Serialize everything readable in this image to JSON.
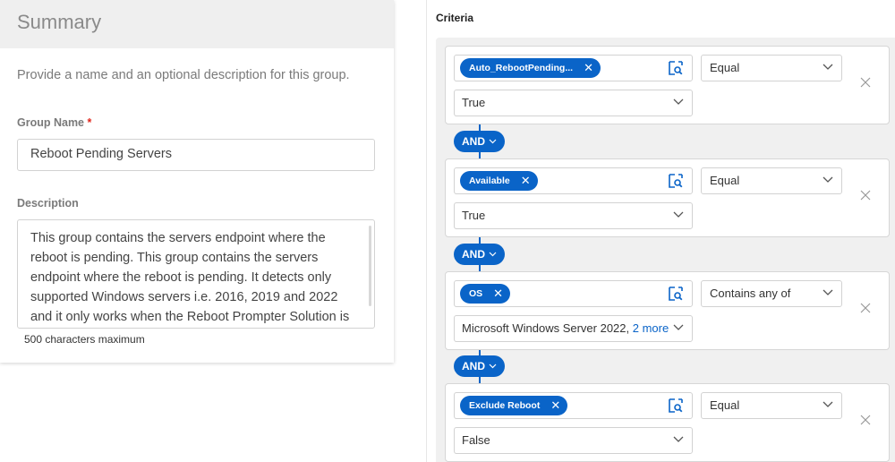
{
  "summary": {
    "title": "Summary",
    "intro": "Provide a name and an optional description for this group.",
    "group_name_label": "Group Name",
    "required_mark": "*",
    "group_name_value": "Reboot Pending Servers",
    "description_label": "Description",
    "description_value": "This group contains the servers endpoint where the reboot is pending. This group contains the servers endpoint where the reboot is pending. It detects only supported Windows servers i.e. 2016, 2019 and 2022 and it only works when the Reboot Prompter Solution is activated.",
    "char_hint": "500 characters maximum"
  },
  "criteria": {
    "label": "Criteria",
    "accent_color": "#0a64c8",
    "rules": [
      {
        "field": "Auto_RebootPending...",
        "operator": "Equal",
        "value": "True",
        "value_more": ""
      },
      {
        "field": "Available",
        "operator": "Equal",
        "value": "True",
        "value_more": ""
      },
      {
        "field": "OS",
        "operator": "Contains any of",
        "value": "Microsoft Windows Server 2022,",
        "value_more": "2 more"
      },
      {
        "field": "Exclude Reboot",
        "operator": "Equal",
        "value": "False",
        "value_more": ""
      }
    ],
    "connectors": [
      "AND",
      "AND",
      "AND"
    ],
    "icons": {
      "chip_remove": "close-icon",
      "field_picker": "search-field-icon",
      "dropdown": "chevron-down-icon",
      "rule_remove": "close-icon"
    }
  }
}
